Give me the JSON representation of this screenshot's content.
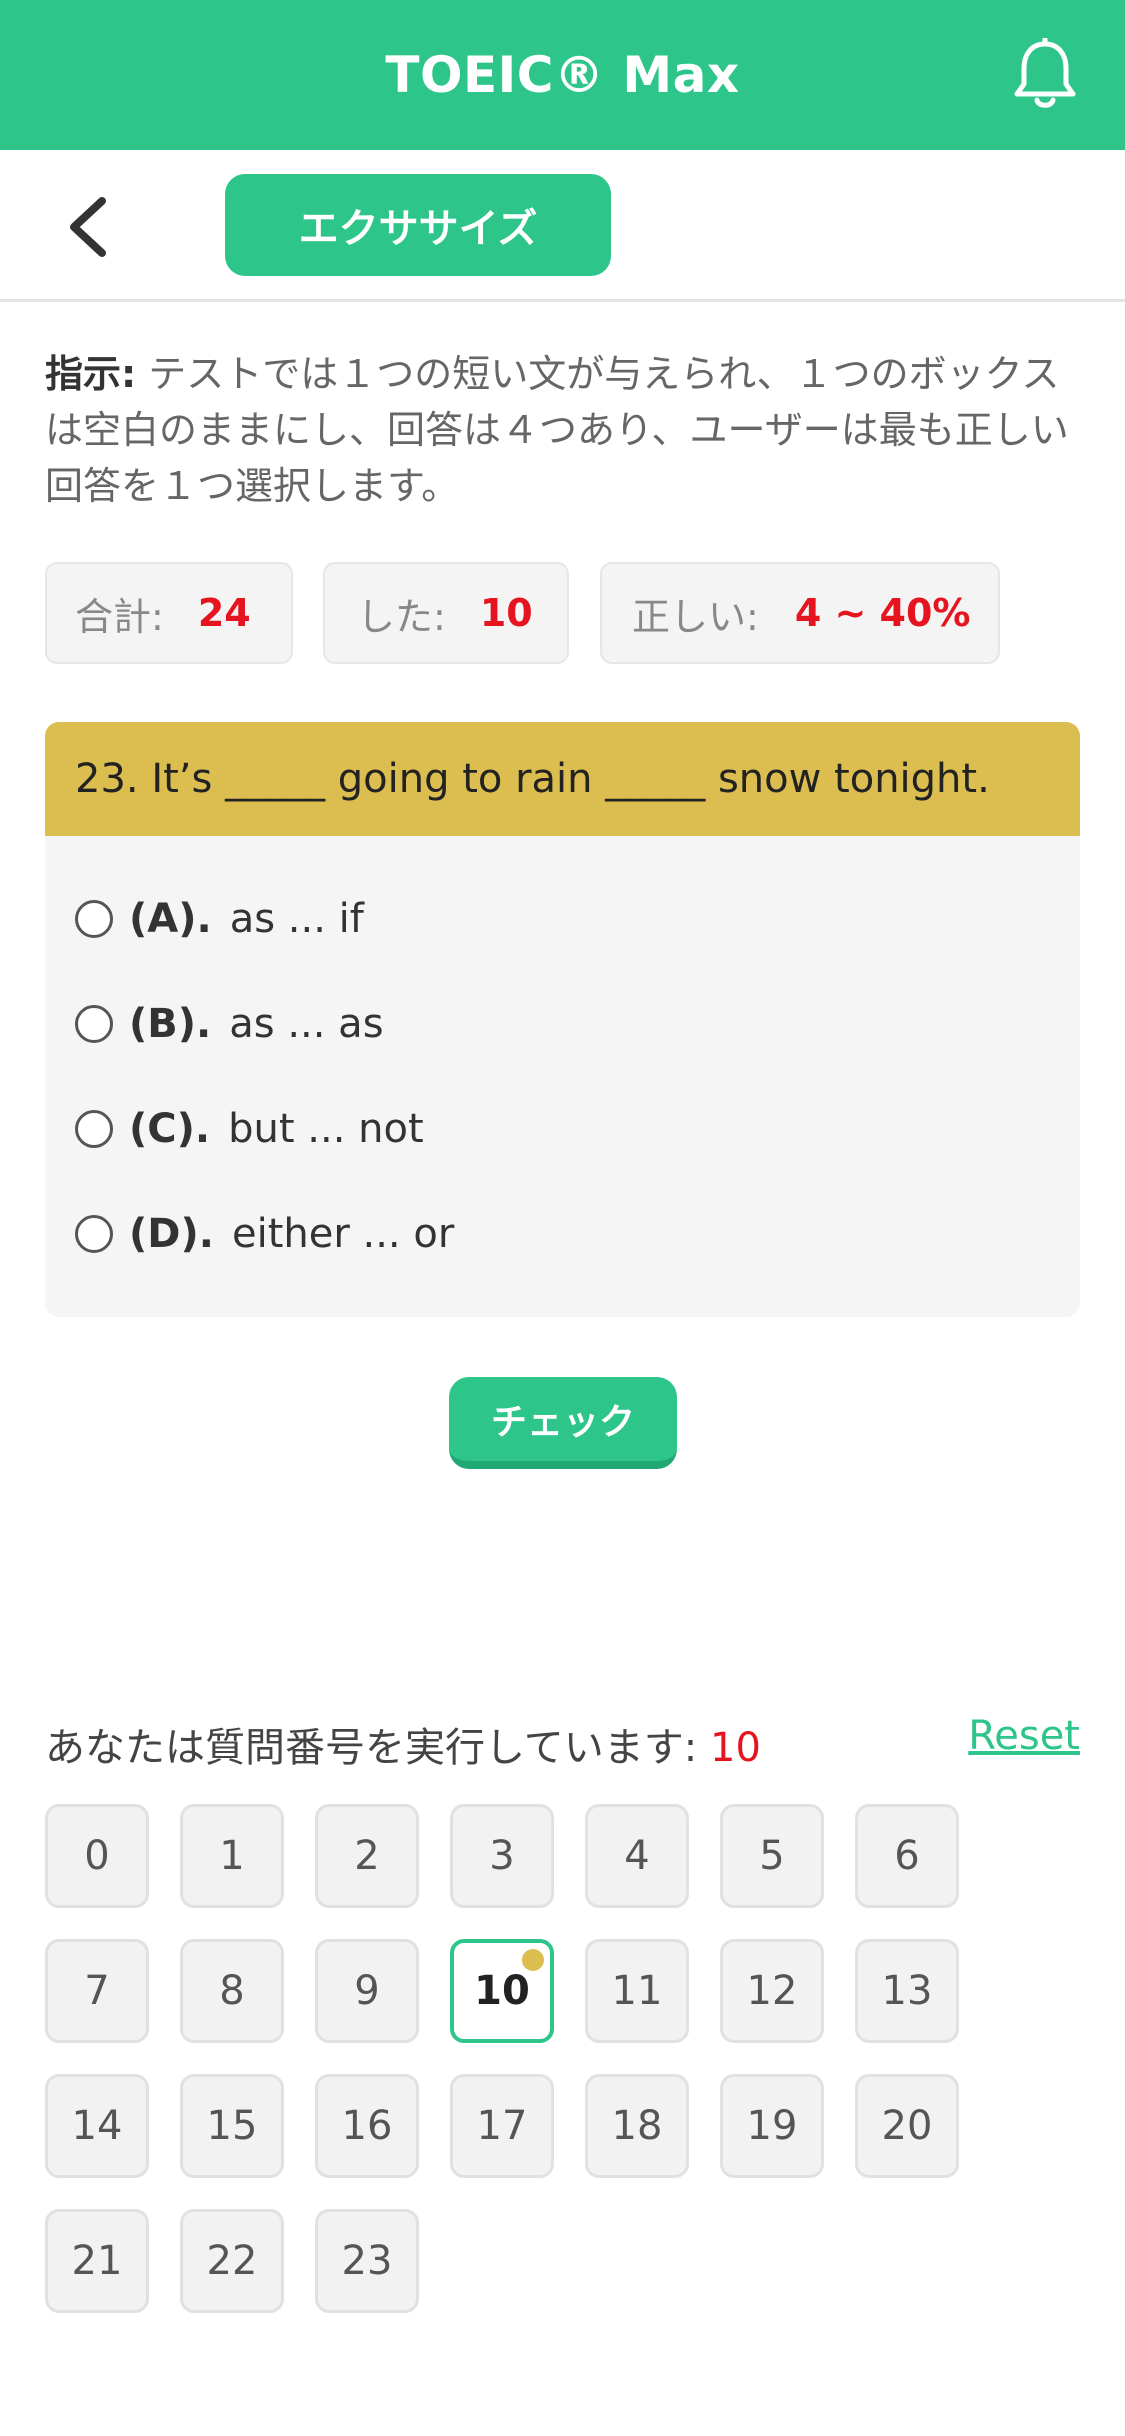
{
  "header": {
    "title": "TOEIC® Max",
    "notification_icon": "bell-icon"
  },
  "subbar": {
    "back_icon": "chevron-left-icon",
    "tab_label": "エクササイズ"
  },
  "instructions": {
    "label": "指示:",
    "text": " テストでは１つの短い文が与えられ、１つのボックスは空白のままにし、回答は４つあり、ユーザーは最も正しい回答を１つ選択します。"
  },
  "stats": {
    "total_label": "合計:",
    "total_value": "24",
    "done_label": "した:",
    "done_value": "10",
    "correct_label": "正しい:",
    "correct_value": "4 ~ 40%"
  },
  "question": {
    "text": "23. It’s _____ going to rain _____ snow tonight.",
    "options": [
      {
        "letter": "(A).",
        "text": "as ... if"
      },
      {
        "letter": "(B).",
        "text": "as ... as"
      },
      {
        "letter": "(C).",
        "text": "but ... not"
      },
      {
        "letter": "(D).",
        "text": "either ... or"
      }
    ]
  },
  "check_button": "チェック",
  "progress": {
    "label": "あなたは質問番号を実行しています:",
    "current": "10",
    "reset_label": "Reset"
  },
  "question_numbers": [
    "0",
    "1",
    "2",
    "3",
    "4",
    "5",
    "6",
    "7",
    "8",
    "9",
    "10",
    "11",
    "12",
    "13",
    "14",
    "15",
    "16",
    "17",
    "18",
    "19",
    "20",
    "21",
    "22",
    "23"
  ],
  "active_index": 10,
  "colors": {
    "primary": "#2ec58b",
    "question_header": "#dbbe4f",
    "highlight": "#e6141e"
  }
}
